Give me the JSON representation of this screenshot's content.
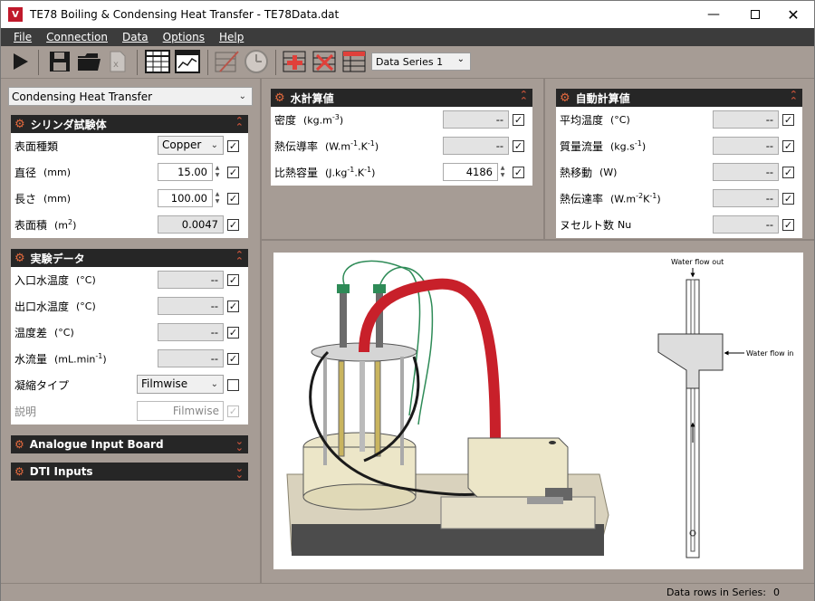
{
  "window": {
    "title": "TE78 Boiling & Condensing Heat Transfer - TE78Data.dat"
  },
  "menu": [
    "File",
    "Connection",
    "Data",
    "Options",
    "Help"
  ],
  "toolbar": {
    "series_select": "Data Series 1"
  },
  "mode_dropdown": "Condensing Heat Transfer",
  "cylinder": {
    "title": "シリンダ試験体",
    "rows": [
      {
        "label": "表面種類",
        "unit": "",
        "value": "Copper"
      },
      {
        "label": "直径",
        "unit": "(mm)",
        "value": "15.00"
      },
      {
        "label": "長さ",
        "unit": "(mm)",
        "value": "100.00"
      },
      {
        "label": "表面積",
        "unit": "(m",
        "sup": "2",
        "unit_end": ")",
        "value": "0.0047"
      }
    ]
  },
  "experiment": {
    "title": "実験データ",
    "rows": [
      {
        "label": "入口水温度",
        "unit": "(°C)",
        "value": "--"
      },
      {
        "label": "出口水温度",
        "unit": "(°C)",
        "value": "--"
      },
      {
        "label": "温度差",
        "unit": "(°C)",
        "value": "--"
      },
      {
        "label": "水流量",
        "unit": "(mL.min",
        "sup": "-1",
        "unit_end": ")",
        "value": "--"
      },
      {
        "label": "凝縮タイプ",
        "unit": "",
        "value": "Filmwise"
      },
      {
        "label": "説明",
        "unit": "",
        "value": "Filmwise"
      }
    ]
  },
  "analogue": {
    "title": "Analogue Input Board"
  },
  "dti": {
    "title": "DTI Inputs"
  },
  "water_calc": {
    "title": "水計算値",
    "rows": [
      {
        "label": "密度",
        "unit": "(kg.m",
        "sup": "-3",
        "unit_end": ")",
        "value": "--"
      },
      {
        "label": "熱伝導率",
        "unit": "(W.m",
        "sup": "-1",
        "unit_mid": ".K",
        "sup2": "-1",
        "unit_end": ")",
        "value": "--"
      },
      {
        "label": "比熱容量",
        "unit": "(J.kg",
        "sup": "-1",
        "unit_mid": ".K",
        "sup2": "-1",
        "unit_end": ")",
        "value": "4186"
      }
    ]
  },
  "auto_calc": {
    "title": "自動計算値",
    "rows": [
      {
        "label": "平均温度",
        "unit": "(°C)",
        "value": "--"
      },
      {
        "label": "質量流量",
        "unit": "(kg.s",
        "sup": "-1",
        "unit_end": ")",
        "value": "--"
      },
      {
        "label": "熱移動",
        "unit": "(W)",
        "value": "--"
      },
      {
        "label": "熱伝達率",
        "unit": "(W.m",
        "sup": "-2",
        "unit_mid": "K",
        "sup2": "-1",
        "unit_end": ")",
        "value": "--"
      },
      {
        "label": "ヌセルト数",
        "unit": "Nu",
        "value": "--"
      }
    ]
  },
  "diagram": {
    "flow_out": "Water flow out",
    "flow_in": "Water flow in"
  },
  "status": {
    "label": "Data rows in Series:",
    "value": "0"
  },
  "colors": {
    "panel_header": "#262626",
    "background": "#a69c95",
    "accent": "#e56a3e",
    "menu": "#3c3c3c"
  }
}
